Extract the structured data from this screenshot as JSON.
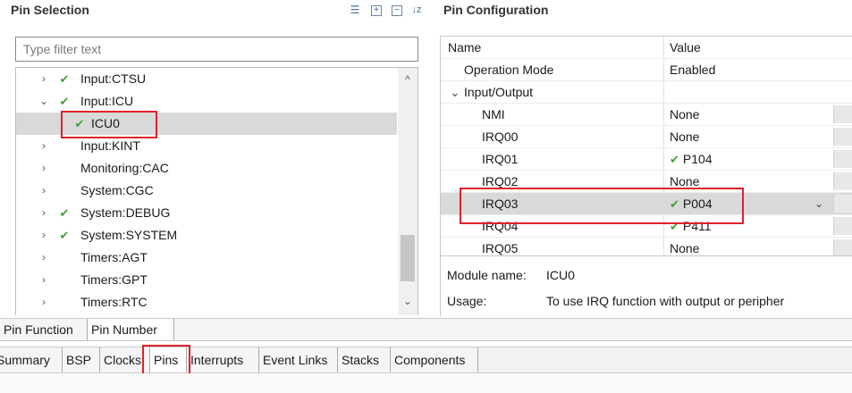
{
  "left_panel": {
    "title": "Pin Selection",
    "toolbar_icons": [
      "list-icon",
      "expand-all-icon",
      "collapse-all-icon",
      "sort-az-icon"
    ],
    "filter_placeholder": "Type filter text",
    "tree": [
      {
        "label": "Input:CTSU",
        "expanded": false,
        "checked": true,
        "level": 0
      },
      {
        "label": "Input:ICU",
        "expanded": true,
        "checked": true,
        "level": 0
      },
      {
        "label": "ICU0",
        "expanded": null,
        "checked": true,
        "level": 1,
        "selected": true
      },
      {
        "label": "Input:KINT",
        "expanded": false,
        "checked": false,
        "level": 0
      },
      {
        "label": "Monitoring:CAC",
        "expanded": false,
        "checked": false,
        "level": 0
      },
      {
        "label": "System:CGC",
        "expanded": false,
        "checked": false,
        "level": 0
      },
      {
        "label": "System:DEBUG",
        "expanded": false,
        "checked": true,
        "level": 0
      },
      {
        "label": "System:SYSTEM",
        "expanded": false,
        "checked": true,
        "level": 0
      },
      {
        "label": "Timers:AGT",
        "expanded": false,
        "checked": false,
        "level": 0
      },
      {
        "label": "Timers:GPT",
        "expanded": false,
        "checked": false,
        "level": 0
      },
      {
        "label": "Timers:RTC",
        "expanded": false,
        "checked": false,
        "level": 0
      }
    ]
  },
  "right_panel": {
    "title": "Pin Configuration",
    "columns": [
      "Name",
      "Value"
    ],
    "rows": [
      {
        "name": "Operation Mode",
        "value": "Enabled",
        "checked": false
      },
      {
        "name": "Input/Output",
        "value": "",
        "checked": false,
        "group": true
      },
      {
        "name": "NMI",
        "value": "None",
        "checked": false
      },
      {
        "name": "IRQ00",
        "value": "None",
        "checked": false
      },
      {
        "name": "IRQ01",
        "value": "P104",
        "checked": true
      },
      {
        "name": "IRQ02",
        "value": "None",
        "checked": false
      },
      {
        "name": "IRQ03",
        "value": "P004",
        "checked": true,
        "highlighted": true
      },
      {
        "name": "IRQ04",
        "value": "P411",
        "checked": true
      },
      {
        "name": "IRQ05",
        "value": "None",
        "checked": false
      }
    ],
    "module_label": "Module name:",
    "module_value": "ICU0",
    "usage_label": "Usage:",
    "usage_value": "To use IRQ function with output or peripher"
  },
  "pin_tabs": [
    {
      "label": "Pin Function",
      "active": false
    },
    {
      "label": "Pin Number",
      "active": true
    }
  ],
  "editor_tabs": [
    {
      "label": "Summary",
      "active": false
    },
    {
      "label": "BSP",
      "active": false
    },
    {
      "label": "Clocks",
      "active": false
    },
    {
      "label": "Pins",
      "active": true
    },
    {
      "label": "Interrupts",
      "active": false
    },
    {
      "label": "Event Links",
      "active": false
    },
    {
      "label": "Stacks",
      "active": false
    },
    {
      "label": "Components",
      "active": false
    }
  ],
  "colors": {
    "check": "#3d9f3d",
    "annotation": "#e0202a",
    "selection": "#d9d9d9"
  }
}
